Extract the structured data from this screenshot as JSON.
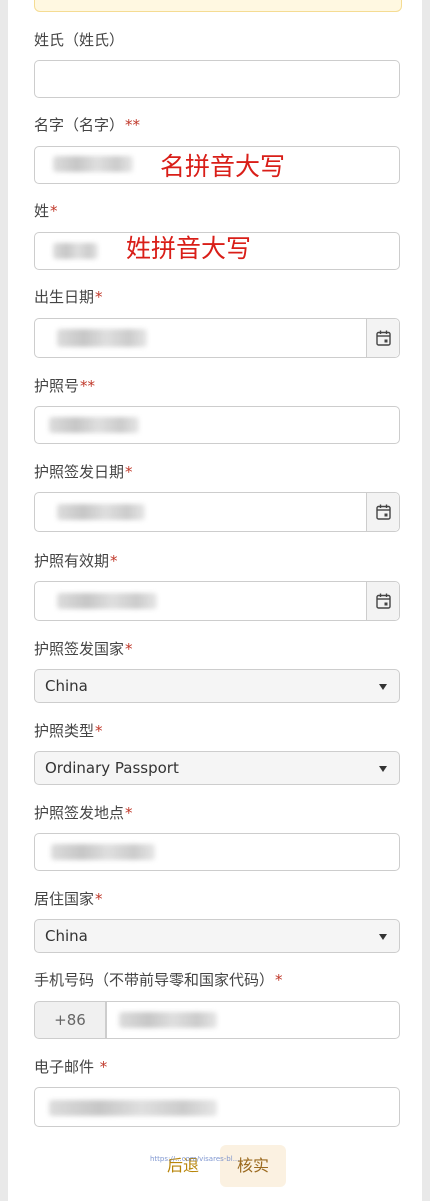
{
  "form": {
    "surname_local_label": "姓氏（姓氏）",
    "surname_local_value": "",
    "given_name_label": "名字（名字）",
    "given_name_req": "**",
    "given_name_note": "名拼音大写",
    "surname_label": "姓",
    "surname_req": "*",
    "surname_note": "姓拼音大写",
    "birth_date_label": "出生日期",
    "birth_date_req": "*",
    "passport_no_label": "护照号",
    "passport_no_req": "**",
    "passport_issue_date_label": "护照签发日期",
    "passport_issue_date_req": "*",
    "passport_expiry_label": "护照有效期",
    "passport_expiry_req": "*",
    "passport_issue_country_label": "护照签发国家",
    "passport_issue_country_req": "*",
    "passport_issue_country_value": "China",
    "passport_type_label": "护照类型",
    "passport_type_req": "*",
    "passport_type_value": "Ordinary Passport",
    "passport_issue_place_label": "护照签发地点",
    "passport_issue_place_req": "*",
    "residence_country_label": "居住国家",
    "residence_country_req": "*",
    "residence_country_value": "China",
    "phone_label": "手机号码（不带前导零和国家代码）",
    "phone_req": "*",
    "phone_prefix": "+86",
    "email_label": "电子邮件",
    "email_req": "*"
  },
  "actions": {
    "back_label": "后退",
    "verify_label": "核实"
  },
  "watermark": "https://...com/visares-bl...",
  "colors": {
    "required": "#c0392b",
    "annotation": "#d91e18",
    "accent_button_bg": "#fbf1e1",
    "accent_text": "#b8860b"
  },
  "icons": {
    "date": "calendar-icon",
    "select": "caret-down-icon"
  }
}
